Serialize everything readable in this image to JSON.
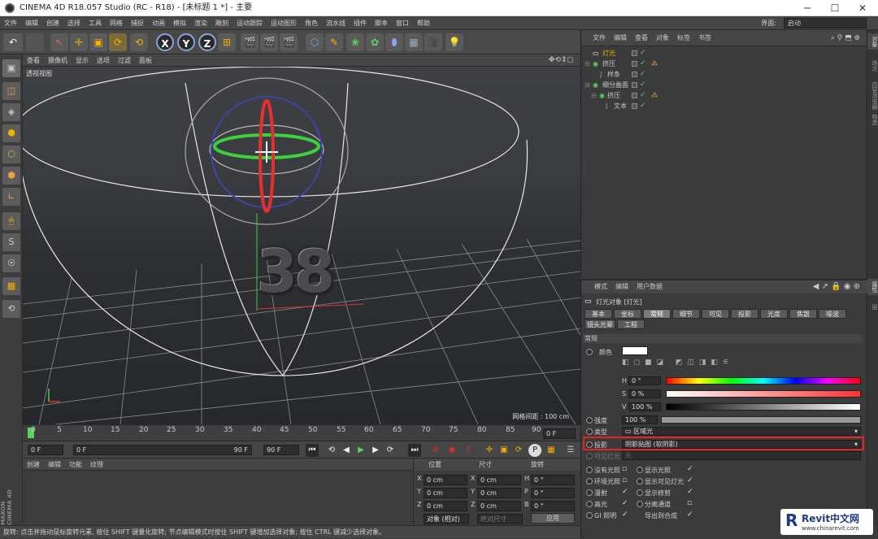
{
  "window": {
    "title": "CINEMA 4D R18.057 Studio (RC - R18) - [未标题 1 *] - 主要",
    "min": "─",
    "max": "☐",
    "close": "✕"
  },
  "menu": [
    "文件",
    "编辑",
    "创建",
    "选择",
    "工具",
    "网格",
    "捕捉",
    "动画",
    "模拟",
    "渲染",
    "雕刻",
    "运动跟踪",
    "运动图形",
    "角色",
    "流水线",
    "插件",
    "脚本",
    "窗口",
    "帮助"
  ],
  "interface": {
    "label": "界面:",
    "value": "启动"
  },
  "toolbar": {
    "undo": "↶",
    "select": "↖",
    "move": "✛",
    "scale": "▣",
    "rotate": "⟳",
    "rot2": "⟲",
    "x": "X",
    "y": "Y",
    "z": "Z",
    "coord": "⊞",
    "render1": "🎬",
    "render2": "🎬",
    "render3": "🎬",
    "cube": "⬡",
    "pen": "✎",
    "gen": "❀",
    "deform": "✿",
    "env": "⬮",
    "floor": "▦",
    "camera": "🎥",
    "light": "💡"
  },
  "leftTools": [
    "▣",
    "◫",
    "◈",
    "⬢",
    "⬡",
    "⬢",
    "∟",
    "🖱",
    "S",
    "☉",
    "▦",
    "⟲"
  ],
  "viewport": {
    "menu": [
      "查看",
      "摄像机",
      "显示",
      "选项",
      "过滤",
      "面板"
    ],
    "corner_icons": "✥⟲⇕◻",
    "label": "透视视图",
    "grid_info": "网格间距 : 100 cm",
    "text3d": "38"
  },
  "timeline": {
    "ticks": [
      "0",
      "5",
      "10",
      "15",
      "20",
      "25",
      "30",
      "35",
      "40",
      "45",
      "50",
      "55",
      "60",
      "65",
      "70",
      "75",
      "80",
      "85",
      "90"
    ],
    "current": "0 F"
  },
  "transport": {
    "start": "0 F",
    "min": "0 F",
    "max": "90 F",
    "end": "90 F"
  },
  "materials": {
    "menu": [
      "创建",
      "编辑",
      "功能",
      "纹理"
    ]
  },
  "coords": {
    "headers": [
      "位置",
      "尺寸",
      "旋转"
    ],
    "rows": [
      {
        "a": "X",
        "p": "0 cm",
        "b": "X",
        "s": "0 cm",
        "c": "H",
        "r": "0 °"
      },
      {
        "a": "Y",
        "p": "0 cm",
        "b": "Y",
        "s": "0 cm",
        "c": "P",
        "r": "0 °"
      },
      {
        "a": "Z",
        "p": "0 cm",
        "b": "Z",
        "s": "0 cm",
        "c": "B",
        "r": "0 °"
      }
    ],
    "mode": "对象 (相对)",
    "size_mode": "绝对尺寸",
    "apply": "应用"
  },
  "status": "旋转: 点击并拖动鼠标旋转元素, 按住 SHIFT 键量化旋转; 节点编辑模式时按住 SHIFT 键增加选择对象; 按住 CTRL 键减少选择对象。",
  "brand": "MAXON CINEMA 4D",
  "objmgr": {
    "menu": [
      "文件",
      "编辑",
      "查看",
      "对象",
      "标签",
      "书签"
    ],
    "objects": [
      {
        "name": "灯光",
        "indent": 0,
        "sel": true
      },
      {
        "name": "挤压",
        "indent": 0,
        "sel": false
      },
      {
        "name": "样条",
        "indent": 1,
        "sel": false
      },
      {
        "name": "细分曲面",
        "indent": 0,
        "sel": false
      },
      {
        "name": "挤压",
        "indent": 1,
        "sel": false
      },
      {
        "name": "文本",
        "indent": 2,
        "sel": false
      }
    ]
  },
  "rtabs": [
    "对象",
    "场次",
    "内容浏览器",
    "构造",
    "属性",
    "层"
  ],
  "attr": {
    "menu": [
      "模式",
      "编辑",
      "用户数据"
    ],
    "title": "灯光对象 [灯光]",
    "tabs_row1": [
      "基本",
      "坐标",
      "常规",
      "细节",
      "可见",
      "投影",
      "光度",
      "焦散",
      "噪波"
    ],
    "tabs_row2": [
      "镜头光晕",
      "工程"
    ],
    "section": "常规",
    "color_label": "颜色",
    "h_label": "H",
    "h_val": "0 °",
    "s_label": "S",
    "s_val": "0 %",
    "v_label": "V",
    "v_val": "100 %",
    "intensity_label": "强度",
    "intensity_val": "100 %",
    "type_label": "类型",
    "type_val": "区域光",
    "shadow_label": "投影",
    "shadow_val": "阴影贴图 (软阴影)",
    "visible_label": "可见灯光",
    "visible_val": "无",
    "checks": [
      {
        "l": "没有光照",
        "r": "显示光照"
      },
      {
        "l": "环境光照",
        "r": "显示可见灯光"
      },
      {
        "l": "漫射",
        "r": "显示修剪"
      },
      {
        "l": "高光",
        "r": "分离通道"
      },
      {
        "l": "GI 照明",
        "r": "导出到合成"
      }
    ]
  },
  "watermark": {
    "title": "Revit中文网",
    "url": "www.chinarevit.com"
  }
}
